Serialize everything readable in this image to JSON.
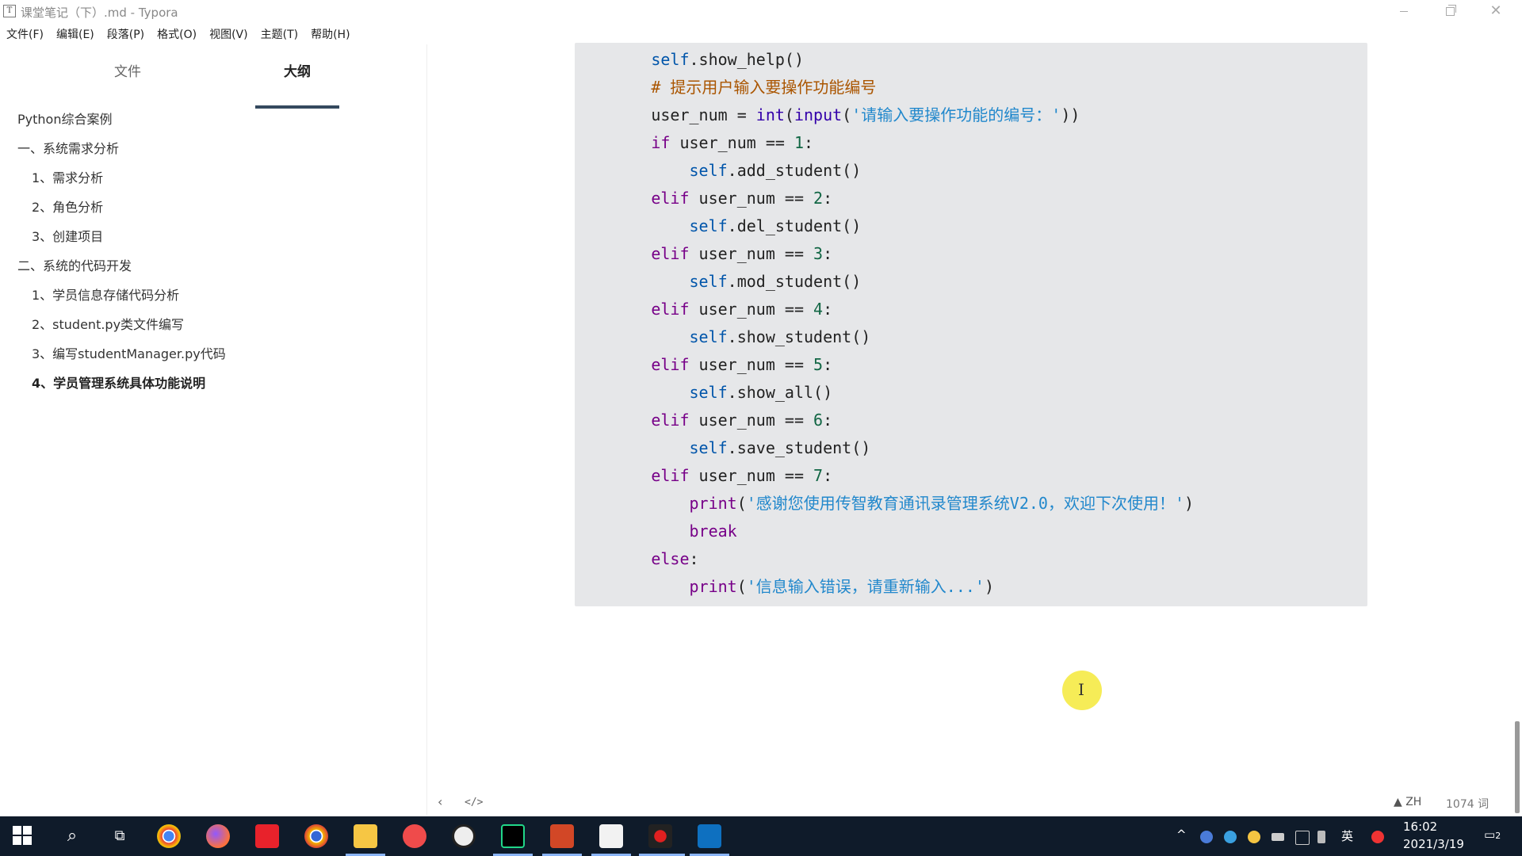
{
  "window": {
    "app_icon": "T",
    "title": "课堂笔记（下）.md - Typora",
    "close_glyph": "✕"
  },
  "menu": [
    "文件(F)",
    "编辑(E)",
    "段落(P)",
    "格式(O)",
    "视图(V)",
    "主题(T)",
    "帮助(H)"
  ],
  "sidebar": {
    "tabs": {
      "files": "文件",
      "outline": "大纲"
    },
    "outline": [
      "Python综合案例",
      "一、系统需求分析",
      "1、需求分析",
      "2、角色分析",
      "3、创建项目",
      "二、系统的代码开发",
      "1、学员信息存储代码分析",
      "2、student.py类文件编写",
      "3、编写studentManager.py代码",
      "4、学员管理系统具体功能说明"
    ]
  },
  "code": {
    "lines": [
      "        self.show_help()",
      "        # 提示用户输入要操作功能编号",
      "        user_num = int(input('请输入要操作功能的编号：'))",
      "        if user_num == 1:",
      "            self.add_student()",
      "        elif user_num == 2:",
      "            self.del_student()",
      "        elif user_num == 3:",
      "            self.mod_student()",
      "        elif user_num == 4:",
      "            self.show_student()",
      "        elif user_num == 5:",
      "            self.show_all()",
      "        elif user_num == 6:",
      "            self.save_student()",
      "        elif user_num == 7:",
      "            print('感谢您使用传智教育通讯录管理系统V2.0，欢迎下次使用！')",
      "            break",
      "        else:",
      "            print('信息输入错误，请重新输入...')"
    ]
  },
  "cursor_glyph": "I",
  "footer": {
    "prev_glyph": "‹",
    "source_glyph": "</>",
    "lang": "ZH",
    "word_count": "1074 词"
  },
  "taskbar": {
    "apps": [
      "start-icon",
      "search-icon",
      "task-view-icon",
      "chrome-icon",
      "firefox-icon",
      "youdao-icon",
      "chrome-canary-icon",
      "file-explorer-icon",
      "recorder-icon",
      "obs-icon",
      "pycharm-icon",
      "powerpoint-icon",
      "typora-icon",
      "record-icon",
      "vscode-icon"
    ],
    "ime": "英",
    "time": "16:02",
    "date": "2021/3/19",
    "notifications": "2"
  },
  "colors": {
    "code_bg": "#e6e7e9",
    "keyword": "#770088",
    "self": "#0055aa",
    "string": "#2288cc",
    "number": "#116644",
    "comment": "#aa5500",
    "taskbar_bg": "#0f1b2a"
  }
}
